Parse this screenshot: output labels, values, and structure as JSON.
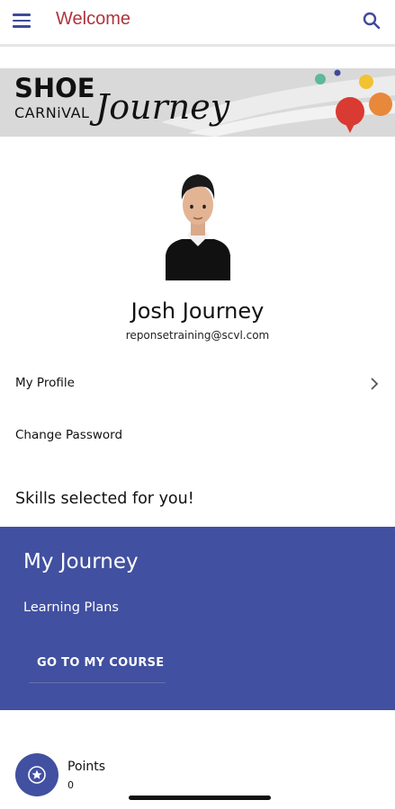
{
  "header": {
    "title": "Welcome",
    "menu_icon": "hamburger-menu-icon",
    "search_icon": "search-icon"
  },
  "banner": {
    "brand_line1": "SHOE",
    "brand_line2": "CARNiVAL",
    "brand_script": "Journey"
  },
  "profile": {
    "name": "Josh Journey",
    "email": "reponsetraining@scvl.com"
  },
  "menu": {
    "my_profile": "My Profile",
    "change_password": "Change Password"
  },
  "skills_heading": "Skills selected for you!",
  "journey_card": {
    "title": "My Journey",
    "subtitle": "Learning Plans",
    "button": "GO TO MY COURSE"
  },
  "points": {
    "label": "Points",
    "value": "0"
  },
  "colors": {
    "accent": "#4150a0",
    "title_red": "#b0343c",
    "banner_gray": "#d9d9d9"
  }
}
